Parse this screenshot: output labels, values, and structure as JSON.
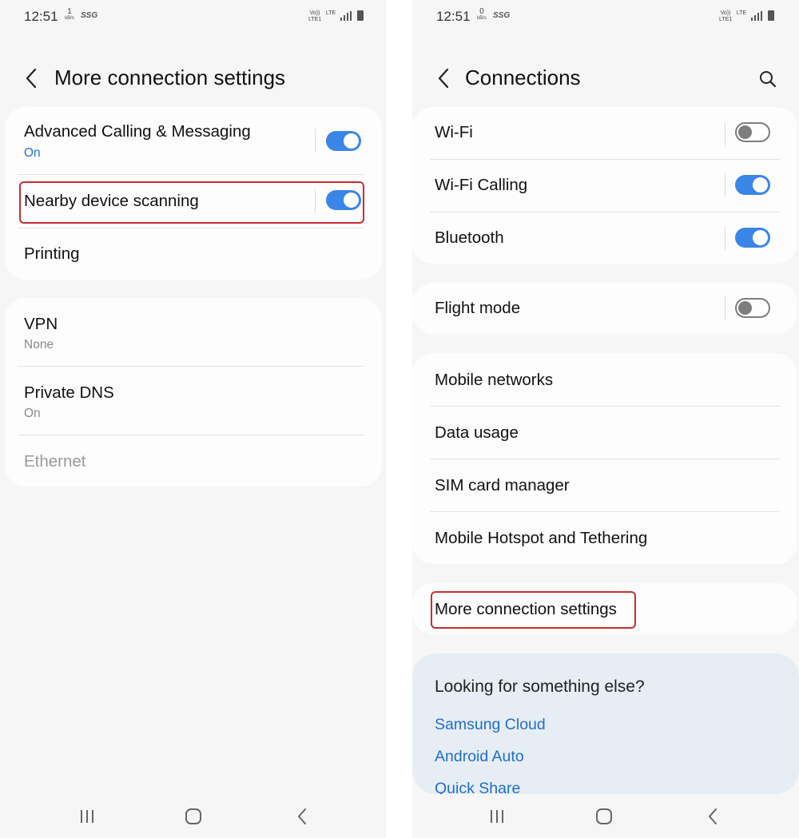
{
  "left": {
    "status": {
      "time": "12:51",
      "net_value": "1",
      "net_unit": "kB/s",
      "carrier": "SSG",
      "volte": "Vo)) LTE1",
      "lte": "LTE"
    },
    "header": {
      "title": "More connection settings"
    },
    "group1": {
      "advanced_calling": {
        "title": "Advanced Calling & Messaging",
        "subtitle": "On",
        "toggle_on": true
      },
      "nearby_scanning": {
        "title": "Nearby device scanning",
        "toggle_on": true
      },
      "printing": {
        "title": "Printing"
      }
    },
    "group2": {
      "vpn": {
        "title": "VPN",
        "subtitle": "None"
      },
      "private_dns": {
        "title": "Private DNS",
        "subtitle": "On"
      },
      "ethernet": {
        "title": "Ethernet"
      }
    }
  },
  "right": {
    "status": {
      "time": "12:51",
      "net_value": "0",
      "net_unit": "kB/s",
      "carrier": "SSG",
      "volte": "Vo)) LTE1",
      "lte": "LTE"
    },
    "header": {
      "title": "Connections"
    },
    "group1": {
      "wifi": {
        "title": "Wi-Fi",
        "toggle_on": false
      },
      "wifi_calling": {
        "title": "Wi-Fi Calling",
        "toggle_on": true
      },
      "bluetooth": {
        "title": "Bluetooth",
        "toggle_on": true
      }
    },
    "group2": {
      "flight_mode": {
        "title": "Flight mode",
        "toggle_on": false
      }
    },
    "group3": {
      "mobile_networks": {
        "title": "Mobile networks"
      },
      "data_usage": {
        "title": "Data usage"
      },
      "sim_manager": {
        "title": "SIM card manager"
      },
      "hotspot": {
        "title": "Mobile Hotspot and Tethering"
      }
    },
    "group4": {
      "more_settings": {
        "title": "More connection settings"
      }
    },
    "suggestions": {
      "title": "Looking for something else?",
      "links": [
        "Samsung Cloud",
        "Android Auto",
        "Quick Share"
      ]
    }
  },
  "icons": {
    "back": "chevron-left-icon",
    "search": "search-icon",
    "recents": "recents-icon",
    "home": "home-icon",
    "nav_back": "nav-back-icon"
  },
  "colors": {
    "accent": "#3a86e8",
    "link": "#1f6fcb",
    "highlight": "#c62e34",
    "background": "#f6f6f6",
    "card": "#fdfdfd"
  }
}
